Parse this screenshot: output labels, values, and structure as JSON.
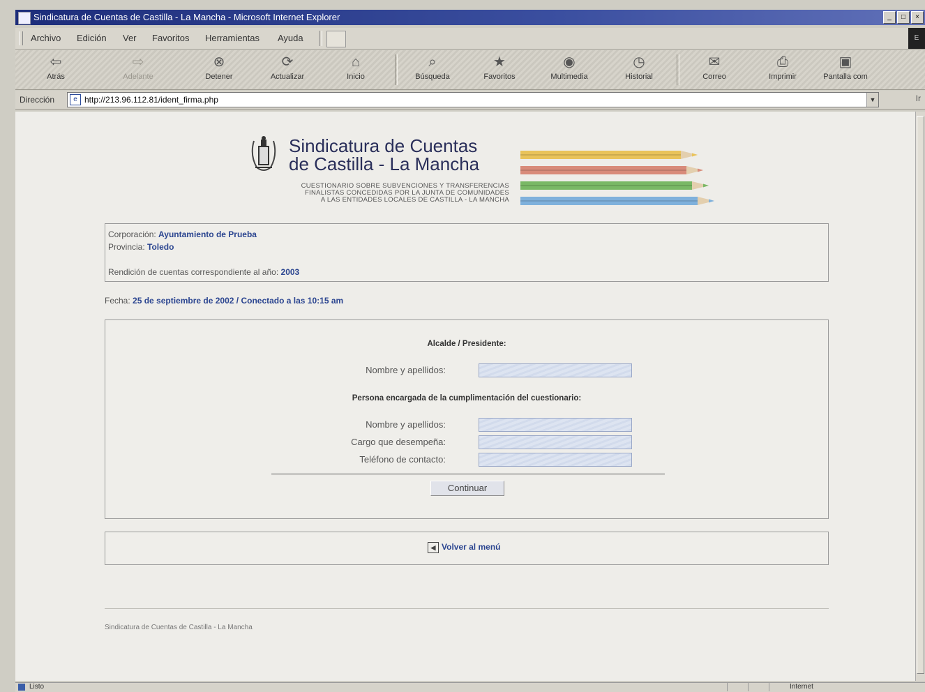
{
  "window": {
    "title": "Sindicatura de Cuentas de Castilla - La Mancha - Microsoft Internet Explorer",
    "controls": [
      "_",
      "□",
      "×"
    ]
  },
  "menu": {
    "items": [
      "Archivo",
      "Edición",
      "Ver",
      "Favoritos",
      "Herramientas",
      "Ayuda"
    ],
    "right_logo": "E"
  },
  "toolbar": {
    "buttons": [
      {
        "label": "Atrás",
        "icon": "back-arrow-icon",
        "glyph": "⇦"
      },
      {
        "label": "Adelante",
        "icon": "forward-arrow-icon",
        "glyph": "⇨"
      },
      {
        "label": "Detener",
        "icon": "stop-icon",
        "glyph": "⊗"
      },
      {
        "label": "Actualizar",
        "icon": "refresh-icon",
        "glyph": "⟳"
      },
      {
        "label": "Inicio",
        "icon": "home-icon",
        "glyph": "⌂"
      },
      {
        "label": "Búsqueda",
        "icon": "search-icon",
        "glyph": "⌕"
      },
      {
        "label": "Favoritos",
        "icon": "favorites-icon",
        "glyph": "★"
      },
      {
        "label": "Multimedia",
        "icon": "multimedia-icon",
        "glyph": "◉"
      },
      {
        "label": "Historial",
        "icon": "history-icon",
        "glyph": "◷"
      },
      {
        "label": "Correo",
        "icon": "mail-icon",
        "glyph": "✉"
      },
      {
        "label": "Imprimir",
        "icon": "print-icon",
        "glyph": "⎙"
      },
      {
        "label": "Pantalla com",
        "icon": "fullscreen-icon",
        "glyph": "▣"
      }
    ]
  },
  "address": {
    "label": "Dirección",
    "url": "http://213.96.112.81/ident_firma.php",
    "go_label": "Ir"
  },
  "page": {
    "logo_title_line1": "Sindicatura de Cuentas",
    "logo_title_line2": "de Castilla - La Mancha",
    "logo_sub_line1": "CUESTIONARIO SOBRE SUBVENCIONES Y TRANSFERENCIAS",
    "logo_sub_line2": "FINALISTAS CONCEDIDAS POR LA JUNTA DE COMUNIDADES",
    "logo_sub_line3": "A LAS ENTIDADES LOCALES DE CASTILLA - LA MANCHA",
    "pencil_colors": [
      "#e9c35a",
      "#d88b7a",
      "#79b865",
      "#7fb1dc"
    ],
    "info": {
      "corporacion_label": "Corporación:",
      "corporacion_value": "Ayuntamiento de Prueba",
      "provincia_label": "Provincia:",
      "provincia_value": "Toledo",
      "rendicion_label": "Rendición de cuentas correspondiente al año:",
      "rendicion_value": "2003"
    },
    "fecha_label": "Fecha:",
    "fecha_value": "25 de septiembre de 2002 / Conectado a las 10:15 am",
    "form": {
      "section1": "Alcalde / Presidente:",
      "nombre1_label": "Nombre y apellidos:",
      "section2": "Persona encargada de la cumplimentación del cuestionario:",
      "nombre2_label": "Nombre y apellidos:",
      "cargo_label": "Cargo que desempeña:",
      "telefono_label": "Teléfono de contacto:",
      "submit_label": "Continuar"
    },
    "back_label": "Volver al menú",
    "footer": "Sindicatura de Cuentas de Castilla - La Mancha"
  },
  "status": {
    "text": "Listo",
    "zone": "Internet"
  }
}
